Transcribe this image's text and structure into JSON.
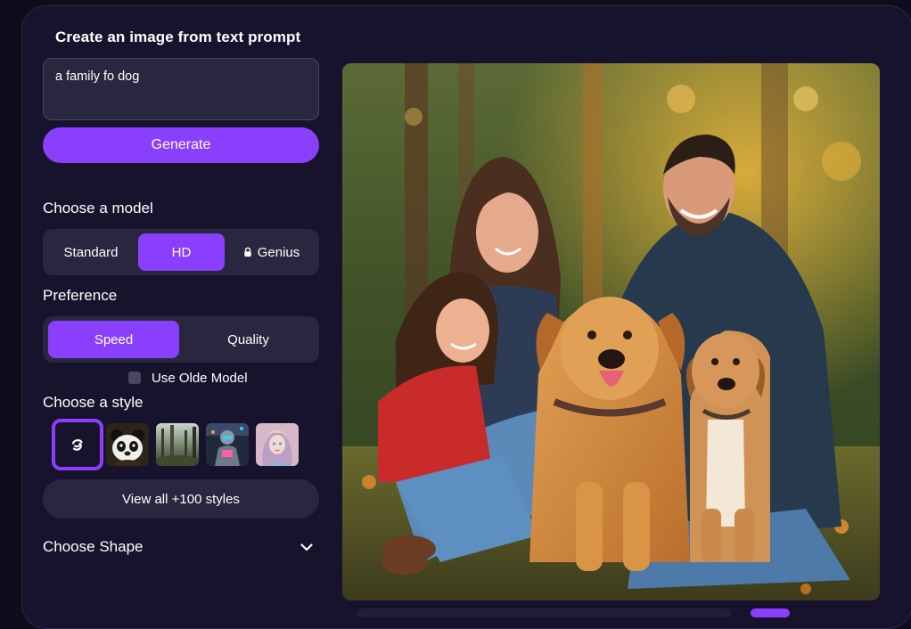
{
  "header": {
    "title": "Create an image from text prompt"
  },
  "prompt": {
    "value": "a family fo dog"
  },
  "generate": {
    "label": "Generate"
  },
  "model": {
    "label": "Choose a model",
    "options": [
      "Standard",
      "HD",
      "Genius"
    ],
    "selected": "HD",
    "locked": [
      "Genius"
    ]
  },
  "preference": {
    "label": "Preference",
    "options": [
      "Speed",
      "Quality"
    ],
    "selected": "Speed"
  },
  "old_model": {
    "label": "Use Olde Model",
    "checked": false
  },
  "style": {
    "label": "Choose a style",
    "thumbnails": [
      "no-style-icon",
      "panda-style",
      "forest-style",
      "robot-style",
      "fantasy-girl-style"
    ],
    "selected": "no-style-icon"
  },
  "view_all": {
    "label": "View all +100 styles"
  },
  "shape": {
    "label": "Choose Shape"
  },
  "colors": {
    "accent": "#8a3ffc",
    "panel": "#17132c",
    "control": "#2a2640",
    "page": "#0f0c1e"
  }
}
